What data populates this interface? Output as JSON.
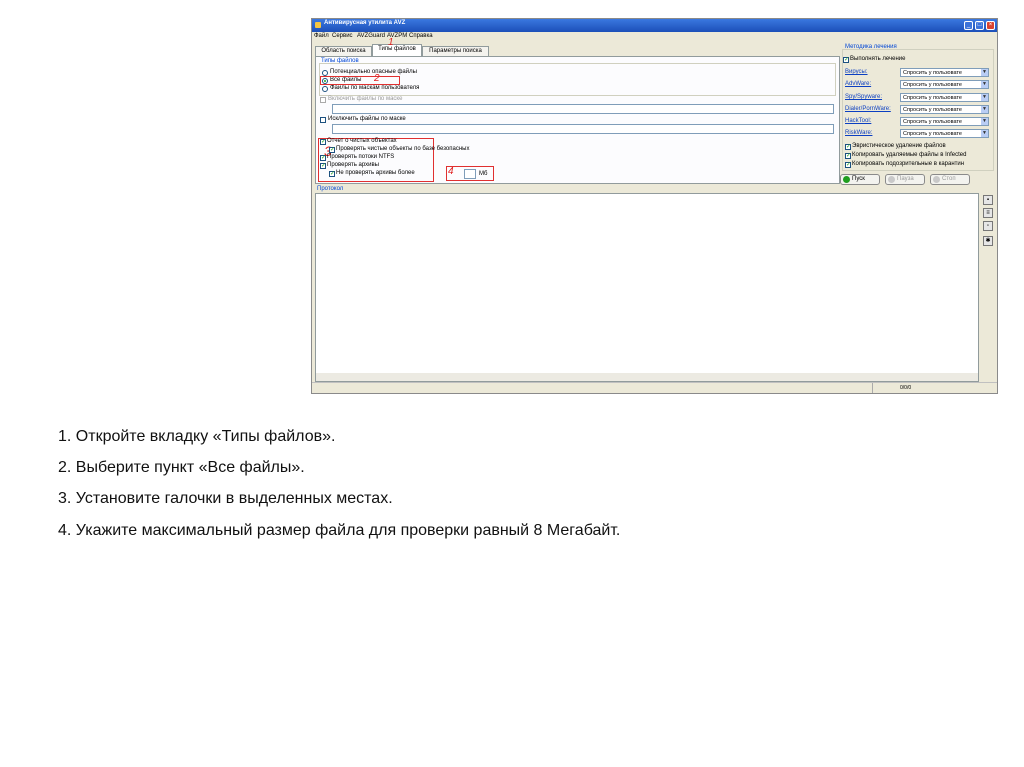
{
  "window": {
    "title": "Антивирусная утилита AVZ",
    "menu": [
      "Файл",
      "Сервис",
      "AVZGuard",
      "AVZPM",
      "Справка"
    ],
    "tabs": [
      "Область поиска",
      "Типы файлов",
      "Параметры поиска"
    ],
    "active_tab_index": 1
  },
  "file_types": {
    "group_label": "Типы файлов",
    "options": [
      "Потенциально опасные файлы",
      "Все файлы",
      "Файлы по маскам пользователя"
    ],
    "selected_option_index": 1,
    "include_mask_label": "Включить файлы по маске",
    "exclude_mask_label": "Исключить файлы по маске",
    "checks": [
      {
        "label": "Отчет о чистых объектах",
        "checked": true
      },
      {
        "label": "Проверять чистые объекты по базе безопасных",
        "checked": true
      },
      {
        "label": "Проверять потоки NTFS",
        "checked": true
      },
      {
        "label": "Проверять архивы",
        "checked": true
      },
      {
        "label": "Не проверять архивы более",
        "checked": true
      }
    ],
    "archive_size_unit": "Мб"
  },
  "annotations": [
    "1",
    "2",
    "3",
    "4"
  ],
  "treatment": {
    "group_label": "Методика лечения",
    "enable_label": "Выполнять лечение",
    "rows": [
      {
        "label": "Вирусы:",
        "value": "Спросить у пользовате"
      },
      {
        "label": "AdvWare:",
        "value": "Спросить у пользовате"
      },
      {
        "label": "Spy/Spyware:",
        "value": "Спросить у пользовате"
      },
      {
        "label": "Dialer/PornWare:",
        "value": "Спросить у пользовате"
      },
      {
        "label": "HackTool:",
        "value": "Спросить у пользовате"
      },
      {
        "label": "RiskWare:",
        "value": "Спросить у пользовате"
      }
    ],
    "extra_checks": [
      "Эвристическое удаление файлов",
      "Копировать удаляемые файлы в Infected",
      "Копировать подозрительные в карантин"
    ]
  },
  "buttons": {
    "start": "Пуск",
    "pause": "Пауза",
    "stop": "Стоп"
  },
  "colors": {
    "start_icon": "#1f9e1f",
    "annotation": "#e02020"
  },
  "protocol_label": "Протокол",
  "status_counter": "0/0/0",
  "instructions": [
    "1. Откройте вкладку «Типы файлов».",
    "2. Выберите пункт «Все файлы».",
    "3. Установите галочки в выделенных местах.",
    "4. Укажите максимальный размер файла для проверки равный 8 Мегабайт."
  ]
}
